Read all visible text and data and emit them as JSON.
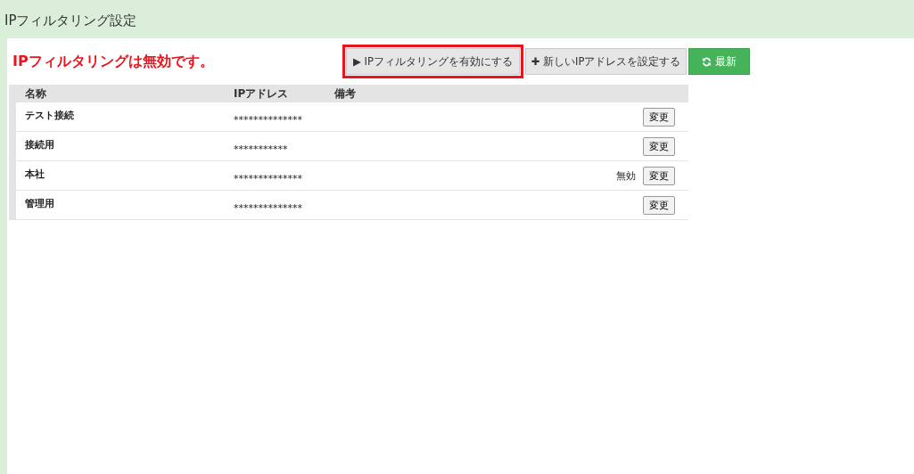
{
  "page_title": "IPフィルタリング設定",
  "status_message": "IPフィルタリングは無効です。",
  "buttons": [
    {
      "kind": "toggle",
      "icon": "▶",
      "label": "IPフィルタリングを有効にする",
      "highlighted": true
    },
    {
      "kind": "add",
      "icon": "✚",
      "label": "新しいIPアドレスを設定する",
      "highlighted": false
    },
    {
      "kind": "refresh",
      "label": "最新",
      "highlighted": false
    }
  ],
  "table": {
    "columns": [
      "名称",
      "IPアドレス",
      "備考"
    ],
    "rows": [
      {
        "name": "テスト接続",
        "ip": "**************",
        "note": "",
        "action": "変更"
      },
      {
        "name": "接続用",
        "ip": "***********",
        "note": "",
        "action": "変更"
      },
      {
        "name": "本社",
        "ip": "**************",
        "note": "無効",
        "action": "変更"
      },
      {
        "name": "管理用",
        "ip": "**************",
        "note": "",
        "action": "変更"
      }
    ]
  }
}
